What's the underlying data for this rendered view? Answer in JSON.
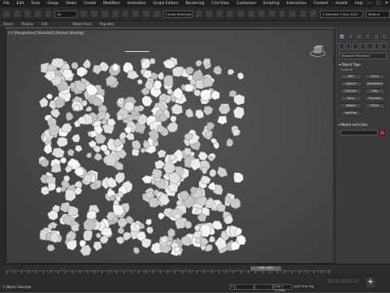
{
  "menu": [
    "File",
    "Edit",
    "Tools",
    "Group",
    "Views",
    "Create",
    "Modifiers",
    "Animation",
    "Graph Editors",
    "Rendering",
    "Civil View",
    "Customize",
    "Scripting",
    "Interactive",
    "Content",
    "Arnold",
    "Help"
  ],
  "toolbar": {
    "selection_filter": "Create Selection Se",
    "workspace": "1 Selected 1 Poly 2021",
    "workspace_label": "Default"
  },
  "ribbon": [
    "Select",
    "Display",
    "Edit"
  ],
  "ribbon2": [
    "Object Paint",
    "Populate"
  ],
  "viewport": {
    "label": "[+] [Perspective] [Standard] [Default Shading]"
  },
  "command_panel": {
    "object_category": "Standard Primitives",
    "object_type_header": "Object Type",
    "autogrid": "AutoGrid",
    "primitives": [
      "Box",
      "Cone",
      "Sphere",
      "GeoSphere",
      "Cylinder",
      "Tube",
      "Torus",
      "Pyramid",
      "Teapot",
      "Plane",
      "TextPlus"
    ],
    "name_color_header": "Name and Color",
    "color": "#d11a7a"
  },
  "timeline": {
    "current": "118 / 200"
  },
  "status": {
    "selected": "1 Object Selected",
    "grid": "Grid = 0.254m",
    "add_time_tag": "Add Time Tag",
    "x": "X:",
    "y": "Y:",
    "z": "Z:"
  }
}
